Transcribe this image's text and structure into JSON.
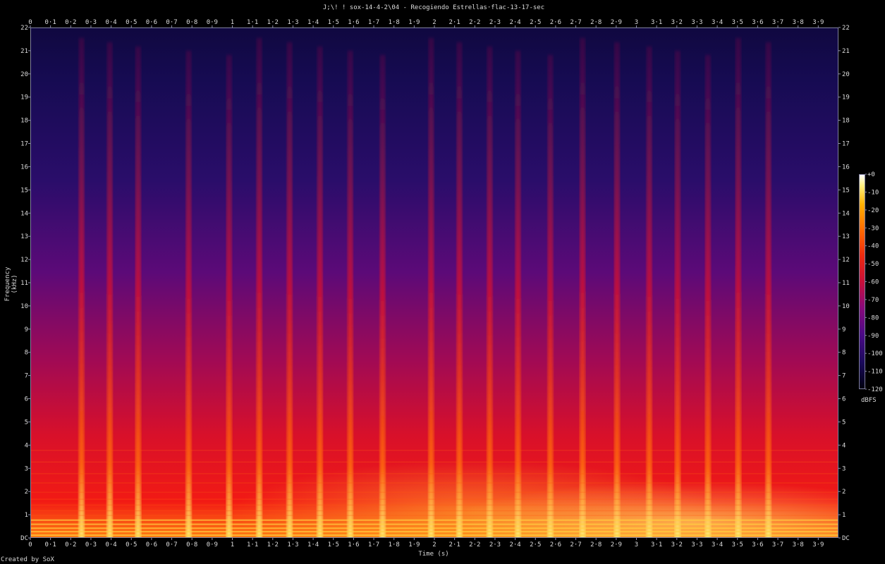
{
  "title": "J;\\! ! sox-14-4-2\\04 - Recogiendo Estrellas·flac-13-17-sec",
  "credit": "Created by SoX",
  "chart_data": {
    "type": "heatmap",
    "title": "J;\\! ! sox-14-4-2\\04 - Recogiendo Estrellas·flac-13-17-sec",
    "xlabel": "Time (s)",
    "ylabel": "Frequency (kHz)",
    "xlim": [
      0,
      4
    ],
    "ylim": [
      0,
      22
    ],
    "x_ticks": [
      "0",
      "0·1",
      "0·2",
      "0·3",
      "0·4",
      "0·5",
      "0·6",
      "0·7",
      "0·8",
      "0·9",
      "1",
      "1·1",
      "1·2",
      "1·3",
      "1·4",
      "1·5",
      "1·6",
      "1·7",
      "1·8",
      "1·9",
      "2",
      "2·1",
      "2·2",
      "2·3",
      "2·4",
      "2·5",
      "2·6",
      "2·7",
      "2·8",
      "2·9",
      "3",
      "3·1",
      "3·2",
      "3·3",
      "3·4",
      "3·5",
      "3·6",
      "3·7",
      "3·8",
      "3·9"
    ],
    "y_ticks": [
      "DC",
      "1",
      "2",
      "3",
      "4",
      "5",
      "6",
      "7",
      "8",
      "9",
      "10",
      "11",
      "12",
      "13",
      "14",
      "15",
      "16",
      "17",
      "18",
      "19",
      "20",
      "21",
      "22"
    ],
    "colorbar": {
      "unit": "dBFS",
      "ticks": [
        "+0",
        "-10",
        "-20",
        "-30",
        "-40",
        "-50",
        "-60",
        "-70",
        "-80",
        "-90",
        "-100",
        "-110",
        "-120"
      ],
      "range": [
        -120,
        0
      ]
    },
    "transients_s": [
      0.25,
      0.39,
      0.53,
      0.78,
      0.98,
      1.13,
      1.28,
      1.43,
      1.58,
      1.74,
      1.98,
      2.12,
      2.27,
      2.41,
      2.57,
      2.73,
      2.9,
      3.06,
      3.2,
      3.35,
      3.5,
      3.65
    ],
    "colors": {
      "low": "#100840",
      "mid": "#c8103a",
      "high": "#ff7a10",
      "peak": "#ffffff"
    }
  }
}
